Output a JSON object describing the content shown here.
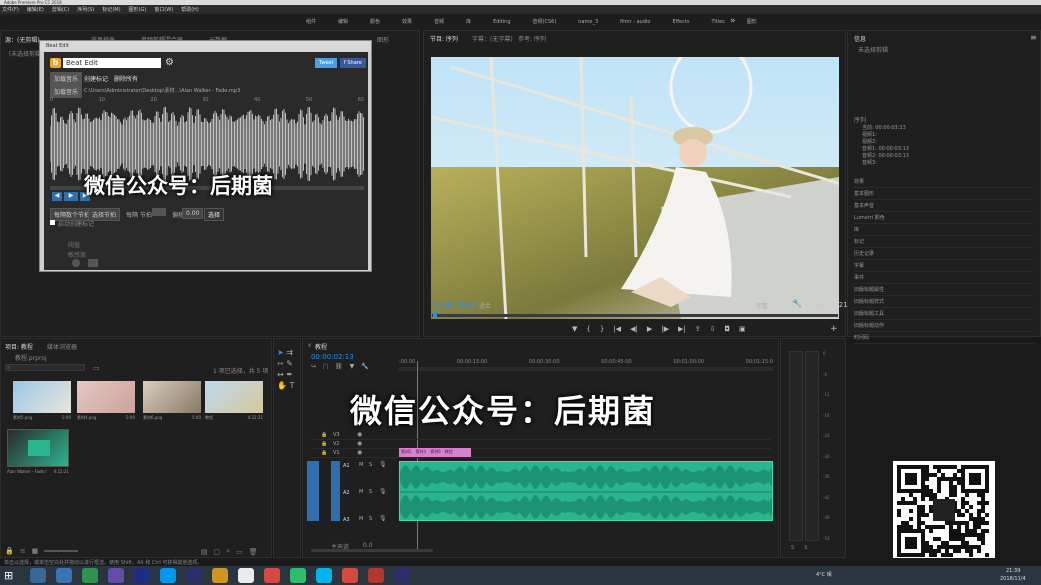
{
  "os_title": "Adobe Premiere Pro CC 2018",
  "menu": [
    "文件(F)",
    "编辑(E)",
    "剪辑(C)",
    "序列(S)",
    "标记(M)",
    "图形(G)",
    "窗口(W)",
    "帮助(H)"
  ],
  "workspaces": [
    "组件",
    "编辑",
    "颜色",
    "效果",
    "音频",
    "库",
    "Editing",
    "音频(CS6)",
    "name_3",
    "filmr - audio",
    "Effects",
    "Titles",
    "图形"
  ],
  "workspaces_more": "»",
  "left_panel": {
    "tab1": "源：(无剪辑)",
    "tab2": "效果控件",
    "tab3": "音频剪辑混合器",
    "tab4": "元数据",
    "tab5": "图形",
    "sub": "（未选择剪辑）"
  },
  "beat_edit": {
    "window_title": "Beat Edit",
    "title": "Beat Edit",
    "tweet": "Tweet",
    "share": "f Share",
    "load_button": "加载音乐",
    "create_markers": "创建标记",
    "delete_all": "删除所有",
    "import_label": "加载音乐",
    "file_path": "C:\\Users\\Administrator\\Desktop\\素材...\\Alan Walker - Fade.mp3",
    "ruler": [
      "0",
      "10",
      "20",
      "30",
      "40",
      "50",
      "60"
    ],
    "mode_select": "每隔数个节拍",
    "beat_select": "选择节拍",
    "every_label": "每隔 节拍",
    "offset_label": "偏移",
    "offset_value": "0.00",
    "select_btn": "选择",
    "checkbox_label": "启动创建标记",
    "settings": [
      "阈值",
      "敏感度"
    ]
  },
  "program": {
    "tab_active": "节目: 序列",
    "tab2": "字幕：(无字幕)",
    "tab3": "参考: 序列",
    "timecode": "00:00:03:13",
    "fit": "适合",
    "full": "完整",
    "duration": "00:04:22:21"
  },
  "info_panel": {
    "title": "信息",
    "subtitle": "未选择剪辑",
    "seq_label": "序列",
    "seq_rows": [
      "当前: 00:00:03:13",
      "视频1:",
      "视频2:",
      "音频1: 00:00:03:13",
      "音频2: 00:00:03:13",
      "音频3:"
    ],
    "items": [
      "效果",
      "基本图形",
      "基本声音",
      "Lumetri 颜色",
      "库",
      "标记",
      "历史记录",
      "字幕",
      "事件",
      "旧版标题属性",
      "旧版标题样式",
      "旧版标题工具",
      "旧版标题动作",
      "时间码"
    ]
  },
  "project": {
    "tab_active": "项目: 教程",
    "tab2": "媒体浏览器",
    "path": "教程.prproj",
    "selection": "1 项已选择，共 5 项",
    "clips": [
      {
        "name": "素材5.png",
        "dur": "5:00"
      },
      {
        "name": "素材4.png",
        "dur": "5:00"
      },
      {
        "name": "素材6.png",
        "dur": "5:00"
      },
      {
        "name": "教程",
        "dur": "4:22:21"
      },
      {
        "name": "Alan Walker - Fade.mp3",
        "dur": "4:22:21"
      }
    ]
  },
  "timeline": {
    "tab": "教程",
    "timecode": "00:00:02:13",
    "ruler": [
      ":00:00",
      "00:00:15:00",
      "00:00:30:00",
      "00:00:45:00",
      "00:01:00:00",
      "00:01:15:0"
    ],
    "tracks_v": [
      "V3",
      "V2",
      "V1"
    ],
    "tracks_a": [
      "A1",
      "A2",
      "A3"
    ],
    "master": "主声道",
    "master_val": "0.0",
    "clip_labels": [
      "素材5",
      "素材4",
      "素材6",
      "教程"
    ]
  },
  "meter": {
    "values": [
      "0",
      "-6",
      "-12",
      "-18",
      "-24",
      "-30",
      "-36",
      "-42",
      "-48",
      "-54"
    ],
    "bottom": [
      "S",
      "S"
    ]
  },
  "watermark_top": "微信公众号：后期菌",
  "watermark_mid": "微信公众号：后期菌",
  "status_bar": "单击以选择，或单击空白处并拖动以进行框选。使用 Shift、Alt 和 Ctrl 可获得其他选项。",
  "taskbar": {
    "time": "21:39",
    "date": "2018/11/4",
    "temp": "4°C 晴"
  },
  "colors": {
    "accent": "#2d8ceb",
    "audio_clip": "#2bb58e",
    "video_clip": "#d97fd0",
    "panel": "#232323"
  }
}
